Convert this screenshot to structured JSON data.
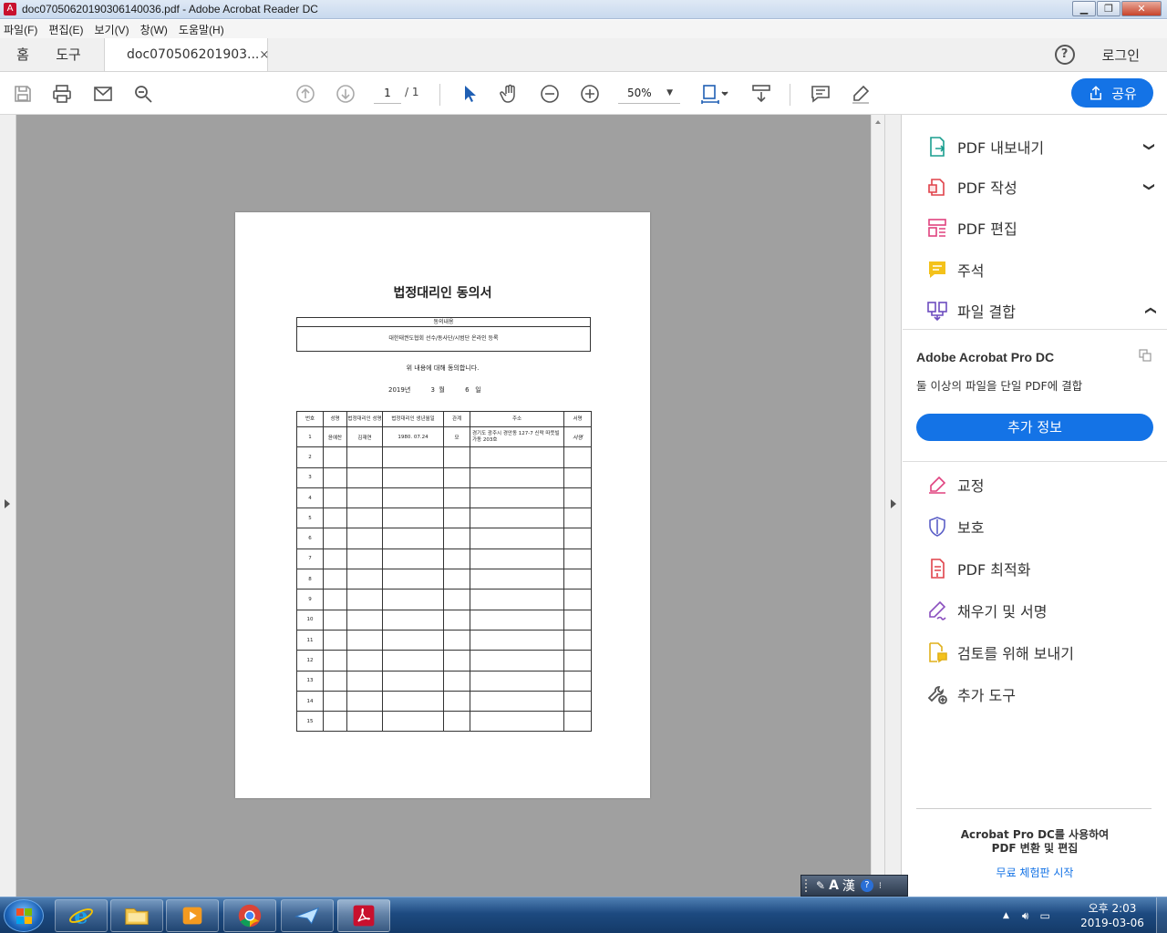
{
  "window": {
    "title": "doc07050620190306140036.pdf - Adobe Acrobat Reader DC"
  },
  "menu": [
    "파일(F)",
    "편집(E)",
    "보기(V)",
    "창(W)",
    "도움말(H)"
  ],
  "tabs": {
    "home": "홈",
    "tools": "도구",
    "document": "doc070506201903...",
    "close": "×",
    "login": "로그인",
    "help": "?"
  },
  "toolbar": {
    "page_current": "1",
    "page_total": "/ 1",
    "zoom": "50%",
    "share": "공유"
  },
  "document": {
    "title": "법정대리인 동의서",
    "consent_header": "동의내용",
    "consent_body": "대한태권도협회 선수/동사단/시범단 온라인 등록",
    "agree_text": "위 내용에 대해 동의합니다.",
    "date_text": "2019년          3  월          6   일",
    "table_headers": [
      "번호",
      "성명",
      "법정대리인 성명",
      "법정대리인 생년월일",
      "관계",
      "주소",
      "서명"
    ],
    "rows": [
      {
        "no": "1",
        "name": "윤예찬",
        "guardian": "김재연",
        "birth": "1980. 07.24",
        "relation": "모",
        "address": "경기도 광주시 경안동 127-7 신락 따뜻빌 가동 203호",
        "signature": "서명"
      },
      {
        "no": "2",
        "name": "",
        "guardian": "",
        "birth": "",
        "relation": "",
        "address": "",
        "signature": ""
      },
      {
        "no": "3",
        "name": "",
        "guardian": "",
        "birth": "",
        "relation": "",
        "address": "",
        "signature": ""
      },
      {
        "no": "4",
        "name": "",
        "guardian": "",
        "birth": "",
        "relation": "",
        "address": "",
        "signature": ""
      },
      {
        "no": "5",
        "name": "",
        "guardian": "",
        "birth": "",
        "relation": "",
        "address": "",
        "signature": ""
      },
      {
        "no": "6",
        "name": "",
        "guardian": "",
        "birth": "",
        "relation": "",
        "address": "",
        "signature": ""
      },
      {
        "no": "7",
        "name": "",
        "guardian": "",
        "birth": "",
        "relation": "",
        "address": "",
        "signature": ""
      },
      {
        "no": "8",
        "name": "",
        "guardian": "",
        "birth": "",
        "relation": "",
        "address": "",
        "signature": ""
      },
      {
        "no": "9",
        "name": "",
        "guardian": "",
        "birth": "",
        "relation": "",
        "address": "",
        "signature": ""
      },
      {
        "no": "10",
        "name": "",
        "guardian": "",
        "birth": "",
        "relation": "",
        "address": "",
        "signature": ""
      },
      {
        "no": "11",
        "name": "",
        "guardian": "",
        "birth": "",
        "relation": "",
        "address": "",
        "signature": ""
      },
      {
        "no": "12",
        "name": "",
        "guardian": "",
        "birth": "",
        "relation": "",
        "address": "",
        "signature": ""
      },
      {
        "no": "13",
        "name": "",
        "guardian": "",
        "birth": "",
        "relation": "",
        "address": "",
        "signature": ""
      },
      {
        "no": "14",
        "name": "",
        "guardian": "",
        "birth": "",
        "relation": "",
        "address": "",
        "signature": ""
      },
      {
        "no": "15",
        "name": "",
        "guardian": "",
        "birth": "",
        "relation": "",
        "address": "",
        "signature": ""
      }
    ]
  },
  "right_panel": {
    "items_top": [
      {
        "label": "PDF 내보내기",
        "icon": "export-pdf-icon",
        "chevron": "down"
      },
      {
        "label": "PDF 작성",
        "icon": "create-pdf-icon",
        "chevron": "down"
      },
      {
        "label": "PDF 편집",
        "icon": "edit-pdf-icon",
        "chevron": ""
      },
      {
        "label": "주석",
        "icon": "comment-icon",
        "chevron": ""
      },
      {
        "label": "파일 결합",
        "icon": "combine-files-icon",
        "chevron": "up"
      }
    ],
    "promo_product": "Adobe Acrobat Pro DC",
    "promo_desc": "둘 이상의 파일을 단일 PDF에 결합",
    "promo_button": "추가 정보",
    "items_bottom": [
      {
        "label": "교정",
        "icon": "redact-icon"
      },
      {
        "label": "보호",
        "icon": "protect-shield-icon"
      },
      {
        "label": "PDF 최적화",
        "icon": "optimize-pdf-icon"
      },
      {
        "label": "채우기 및 서명",
        "icon": "fill-sign-icon"
      },
      {
        "label": "검토를 위해 보내기",
        "icon": "send-for-review-icon"
      },
      {
        "label": "추가 도구",
        "icon": "more-tools-icon"
      }
    ],
    "pro_message_1": "Acrobat Pro DC를 사용하여",
    "pro_message_2": "PDF 변환 및 편집",
    "trial_link": "무료 체험판 시작"
  },
  "ime": {
    "mode": "A",
    "hanja": "漢",
    "help": "?"
  },
  "taskbar": {
    "clock_time": "오후 2:03",
    "clock_date": "2019-03-06"
  },
  "colors": {
    "accent": "#1473e6",
    "doc_background": "#a0a0a0"
  }
}
